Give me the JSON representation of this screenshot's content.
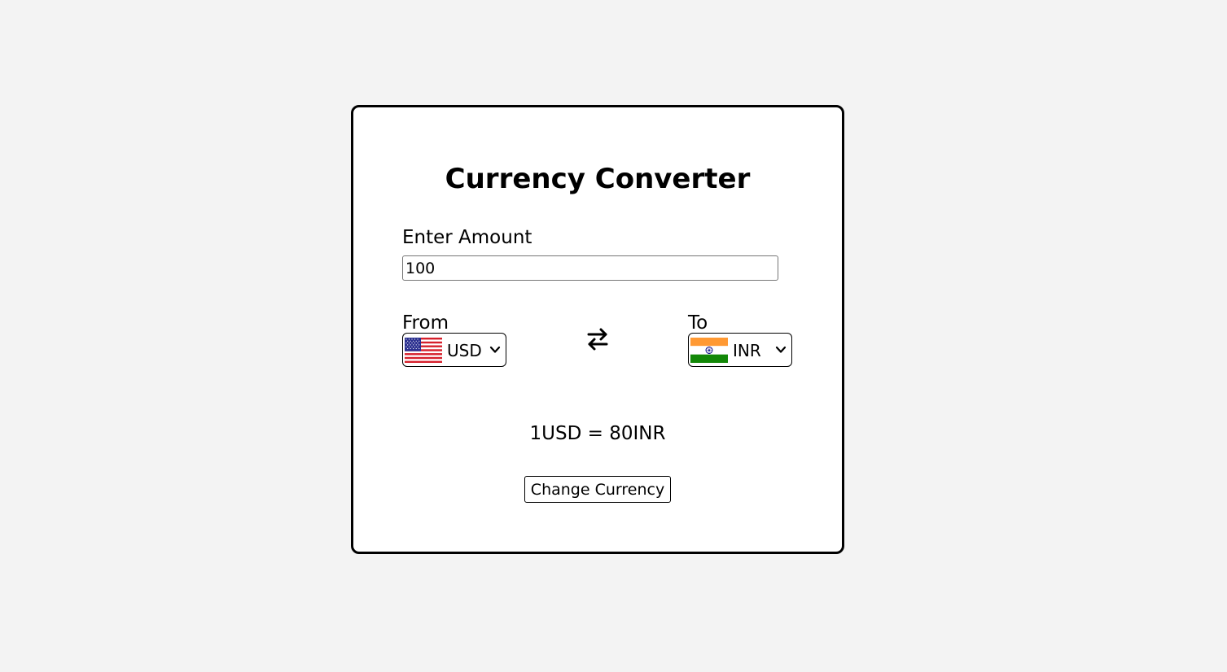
{
  "page": {
    "background_color": "#f3f3f3"
  },
  "converter": {
    "title": "Currency Converter",
    "amount_label": "Enter Amount",
    "amount_value": "100",
    "from_label": "From",
    "to_label": "To",
    "from_currency": {
      "code": "USD",
      "flag_icon": "us-flag-icon"
    },
    "to_currency": {
      "code": "INR",
      "flag_icon": "india-flag-icon"
    },
    "swap_icon": "swap-arrows-icon",
    "rate_text": "1USD = 80INR",
    "button_label": "Change Currency"
  },
  "colors": {
    "card_border": "#000000",
    "us_red": "#d6202c",
    "us_blue": "#2a2f8f",
    "india_saffron": "#ff9933",
    "india_green": "#138808",
    "india_chakra": "#000080"
  }
}
